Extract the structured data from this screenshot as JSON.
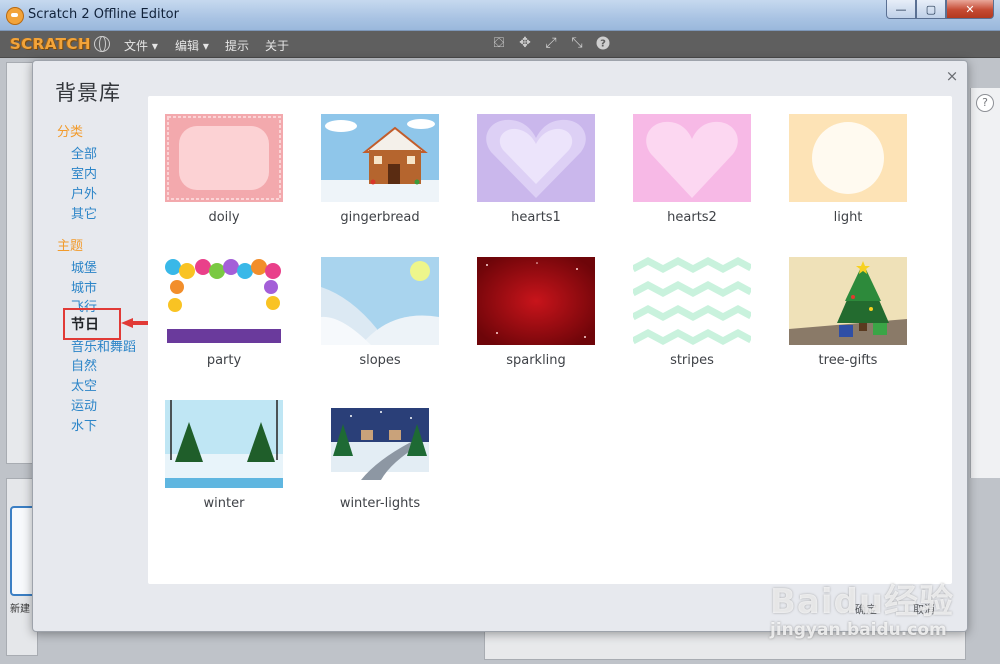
{
  "window": {
    "title": "Scratch 2 Offline Editor",
    "controls": {
      "minimize": "—",
      "maximize": "▢",
      "close": "✕"
    }
  },
  "menubar": {
    "logo": "SCRATCH",
    "items": [
      "文件 ▾",
      "编辑 ▾",
      "提示",
      "关于"
    ],
    "tool_icons": [
      "stamp-icon",
      "move-icon",
      "grow-icon",
      "shrink-icon",
      "help-icon"
    ]
  },
  "app": {
    "help_mark": "?",
    "new_label": "新建"
  },
  "dialog": {
    "title": "背景库",
    "close": "×",
    "ok": "确定",
    "cancel": "取消",
    "categories": {
      "heading": "分类",
      "items": [
        "全部",
        "室内",
        "户外",
        "其它"
      ]
    },
    "themes": {
      "heading": "主题",
      "items": [
        "城堡",
        "城市",
        "飞行",
        "节日",
        "音乐和舞蹈",
        "自然",
        "太空",
        "运动",
        "水下"
      ],
      "selected": "节日"
    },
    "backdrops": [
      {
        "name": "doily"
      },
      {
        "name": "gingerbread"
      },
      {
        "name": "hearts1"
      },
      {
        "name": "hearts2"
      },
      {
        "name": "light"
      },
      {
        "name": "party"
      },
      {
        "name": "slopes"
      },
      {
        "name": "sparkling"
      },
      {
        "name": "stripes"
      },
      {
        "name": "tree-gifts"
      },
      {
        "name": "winter"
      },
      {
        "name": "winter-lights"
      }
    ]
  },
  "watermark": {
    "brand": "Baidu经验",
    "url": "jingyan.baidu.com"
  },
  "colors": {
    "category_heading": "#f29b2c",
    "category_link": "#2c85c8",
    "selection_highlight": "#e13a36"
  }
}
